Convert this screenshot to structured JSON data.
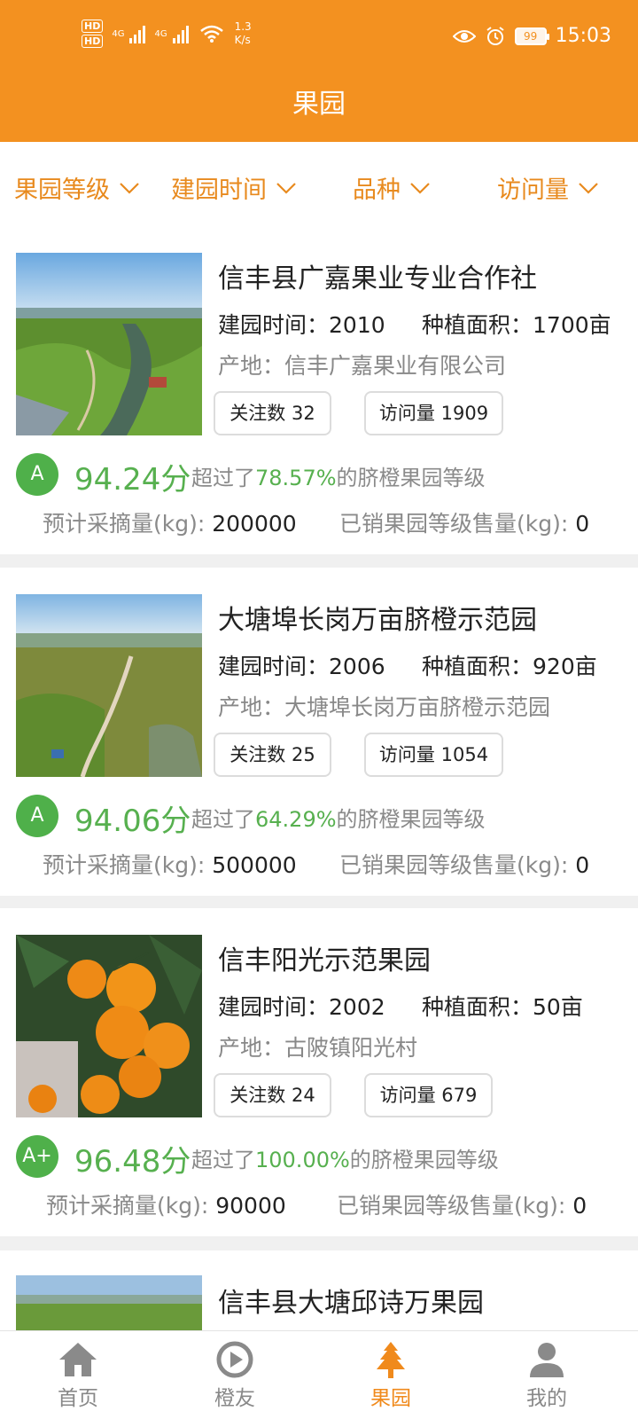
{
  "status_bar": {
    "hd1": "HD",
    "hd2": "HD",
    "sig1": "4G",
    "sig2": "4G",
    "net_speed_value": "1.3",
    "net_speed_unit": "K/s",
    "battery": "99",
    "time": "15:03",
    "icons": [
      "hd-icon",
      "signal-icon",
      "signal-icon",
      "wifi-icon",
      "eye-icon",
      "alarm-icon",
      "battery-icon"
    ]
  },
  "header": {
    "title": "果园"
  },
  "filters": [
    {
      "label": "果园等级"
    },
    {
      "label": "建园时间"
    },
    {
      "label": "品种"
    },
    {
      "label": "访问量"
    }
  ],
  "labels": {
    "founded": "建园时间：",
    "area": "种植面积：",
    "origin": "产地：",
    "follows": "关注数",
    "visits": "访问量",
    "exceed_prefix": "超过了",
    "exceed_suffix": "的脐橙果园等级",
    "harvest": "预计采摘量(kg): ",
    "sold": "已销果园等级售量(kg): "
  },
  "orchards": [
    {
      "name": "信丰县广嘉果业专业合作社",
      "founded": "2010",
      "area": "1700亩",
      "origin": "信丰广嘉果业有限公司",
      "follows": "32",
      "visits": "1909",
      "grade": "A",
      "score": "94.24分",
      "exceed_pct": "78.57%",
      "harvest": "200000",
      "sold": "0"
    },
    {
      "name": "大塘埠长岗万亩脐橙示范园",
      "founded": "2006",
      "area": "920亩",
      "origin": "大塘埠长岗万亩脐橙示范园",
      "follows": "25",
      "visits": "1054",
      "grade": "A",
      "score": "94.06分",
      "exceed_pct": "64.29%",
      "harvest": "500000",
      "sold": "0"
    },
    {
      "name": "信丰阳光示范果园",
      "founded": "2002",
      "area": "50亩",
      "origin": "古陂镇阳光村",
      "follows": "24",
      "visits": "679",
      "grade": "A+",
      "score": "96.48分",
      "exceed_pct": "100.00%",
      "harvest": "90000",
      "sold": "0"
    },
    {
      "name": "信丰县大塘邱诗万果园"
    }
  ],
  "bottom_nav": [
    {
      "label": "首页",
      "icon": "home-icon"
    },
    {
      "label": "橙友",
      "icon": "orange-friends-icon"
    },
    {
      "label": "果园",
      "icon": "orchard-tree-icon",
      "active": true
    },
    {
      "label": "我的",
      "icon": "user-icon"
    }
  ],
  "colors": {
    "brand_orange": "#f39120",
    "filter_text": "#e88a1e",
    "grade_green": "#4fb04a",
    "score_green": "#57b04f"
  }
}
